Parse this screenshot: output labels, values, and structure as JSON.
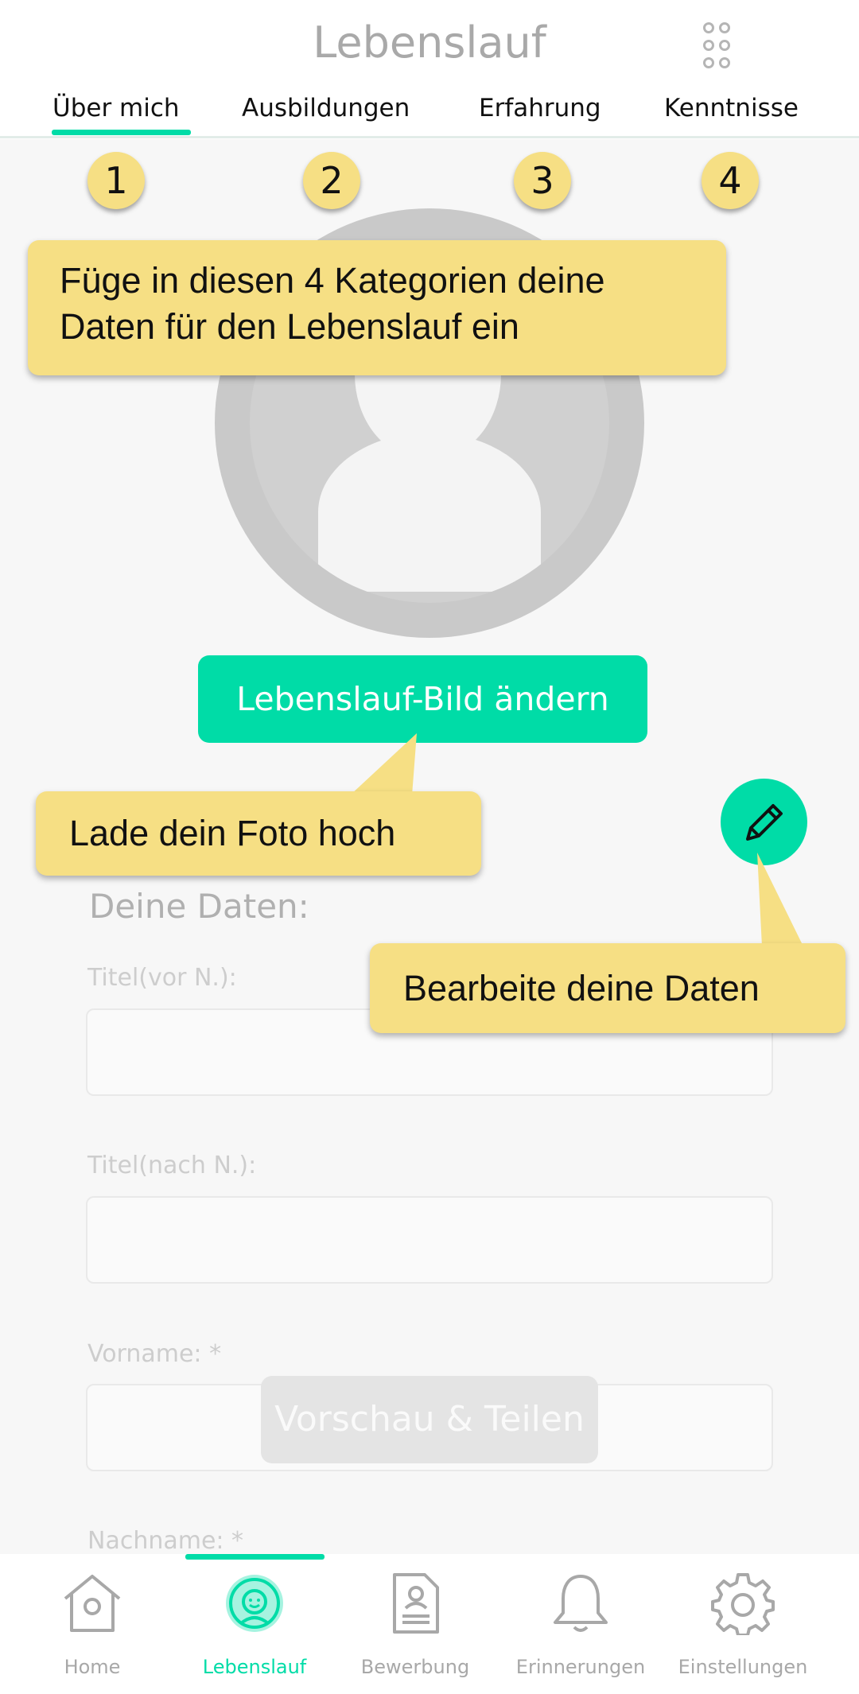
{
  "header": {
    "title": "Lebenslauf",
    "menu_icon": "grid-dots-icon"
  },
  "tabs": [
    {
      "label": "Über mich",
      "active": true
    },
    {
      "label": "Ausbildungen",
      "active": false
    },
    {
      "label": "Erfahrung",
      "active": false
    },
    {
      "label": "Kenntnisse",
      "active": false
    }
  ],
  "badges": [
    "1",
    "2",
    "3",
    "4"
  ],
  "profile": {
    "avatar_icon": "user-silhouette-icon",
    "change_photo_label": "Lebenslauf-Bild ändern",
    "edit_icon": "pencil-icon"
  },
  "form": {
    "section_title": "Deine Daten:",
    "fields": [
      {
        "label": "Titel(vor N.):",
        "value": ""
      },
      {
        "label": "Titel(nach N.):",
        "value": ""
      },
      {
        "label": "Vorname: *",
        "value": ""
      },
      {
        "label": "Nachname: *",
        "value": ""
      }
    ],
    "preview_label": "Vorschau & Teilen"
  },
  "tooltips": {
    "categories_line1": "Füge in diesen 4 Kategorien deine",
    "categories_line2": "Daten für den Lebenslauf ein",
    "upload_photo": "Lade dein Foto hoch",
    "edit_data": "Bearbeite deine Daten"
  },
  "colors": {
    "accent": "#00dca7",
    "tooltip": "#f6df84",
    "inactive": "#a8a8a8"
  },
  "bottom_nav": [
    {
      "label": "Home",
      "icon": "house-icon",
      "active": false
    },
    {
      "label": "Lebenslauf",
      "icon": "cv-face-icon",
      "active": true
    },
    {
      "label": "Bewerbung",
      "icon": "document-person-icon",
      "active": false
    },
    {
      "label": "Erinnerungen",
      "icon": "bell-icon",
      "active": false
    },
    {
      "label": "Einstellungen",
      "icon": "gear-icon",
      "active": false
    }
  ]
}
